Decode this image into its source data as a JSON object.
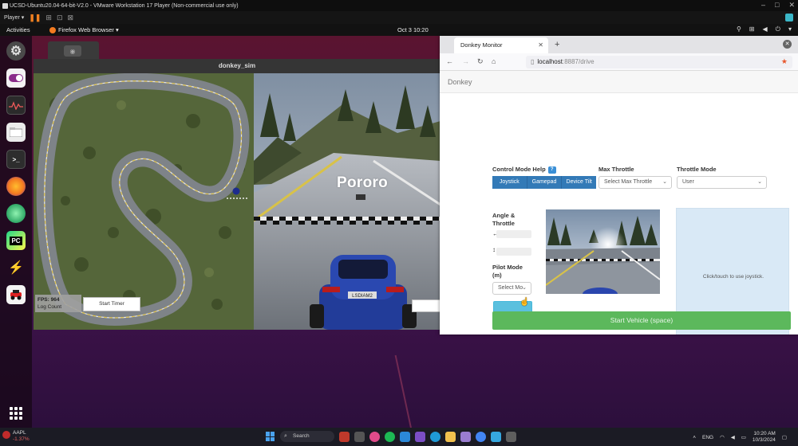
{
  "vmware": {
    "title": "UCSD-Ubuntu20.04-64-bit-V2.0 - VMware Workstation 17 Player (Non-commercial use only)",
    "player_menu": "Player ▾"
  },
  "ubuntu": {
    "activities": "Activities",
    "app_menu": "Firefox Web Browser ▾",
    "clock": "Oct 3  10:20"
  },
  "sim": {
    "window_title": "donkey_sim",
    "fps_text": "FPS: 964",
    "log_count_text": "Log Count",
    "start_timer": "Start Timer",
    "overlay_name": "Pororo",
    "car_plate": "LSDIAM2"
  },
  "firefox": {
    "tab_title": "Donkey Monitor",
    "url_host": "localhost",
    "url_rest": ":8887/drive"
  },
  "monitor": {
    "brand": "Donkey",
    "control_mode_help": "Control Mode Help",
    "modes": [
      "Joystick",
      "Gamepad",
      "Device Tilt"
    ],
    "max_throttle_label": "Max Throttle",
    "max_throttle_select": "Select Max Throttle",
    "throttle_mode_label": "Throttle Mode",
    "throttle_mode_select": "User",
    "angle_throttle_line1": "Angle &",
    "angle_throttle_line2": "Throttle",
    "pilot_mode_line1": "Pilot Mode",
    "pilot_mode_line2": "(m)",
    "pilot_mode_select": "Select Mo",
    "joystick_hint": "Click/touch to use joystick.",
    "start_vehicle": "Start Vehicle (space)"
  },
  "taskbar": {
    "ticker": "AAPL",
    "ticker_change": "-1.37%",
    "search": "Search",
    "lang": "ENG",
    "time": "10:20 AM",
    "date": "10/3/2024"
  },
  "icons": [
    "gear-icon",
    "toggle-icon",
    "monitor-icon",
    "folder-icon",
    "terminal-icon",
    "firefox-icon",
    "globe-icon",
    "pycharm-icon",
    "car-icon",
    "apps-grid-icon"
  ]
}
